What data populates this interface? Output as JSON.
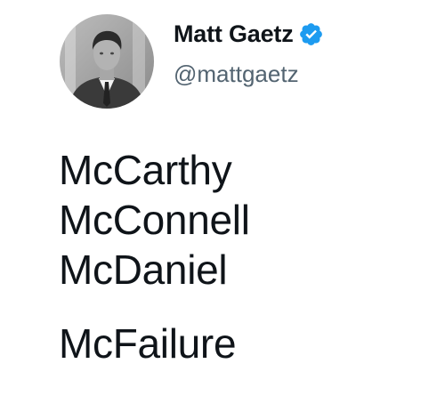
{
  "tweet": {
    "author": {
      "display_name": "Matt Gaetz",
      "handle": "@mattgaetz",
      "verified": true,
      "avatar_icon": "profile-photo",
      "verified_icon": "verified-badge-icon",
      "verified_color": "#1d9bf0"
    },
    "lines": [
      "McCarthy",
      "McConnell",
      "McDaniel",
      "McFailure"
    ]
  },
  "colors": {
    "text": "#0f1419",
    "secondary_text": "#536471",
    "background": "#ffffff",
    "accent": "#1d9bf0"
  }
}
